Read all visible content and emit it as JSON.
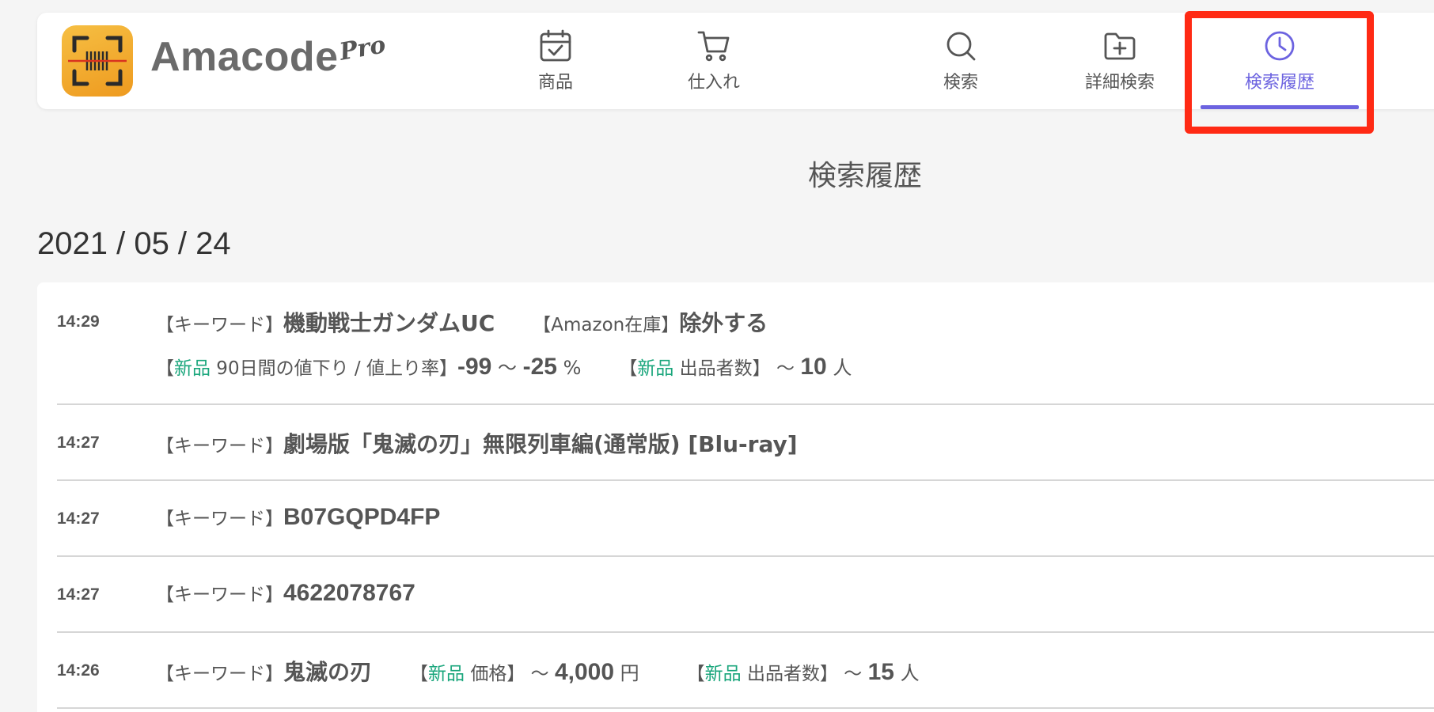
{
  "app": {
    "name": "Amacode",
    "pro_label": "Pro"
  },
  "nav": {
    "items": [
      {
        "label": "商品",
        "icon": "calendar-check-icon"
      },
      {
        "label": "仕入れ",
        "icon": "cart-icon"
      },
      {
        "label": "検索",
        "icon": "search-icon"
      },
      {
        "label": "詳細検索",
        "icon": "folder-plus-icon"
      },
      {
        "label": "検索履歴",
        "icon": "clock-icon",
        "active": true
      }
    ],
    "active_color": "#6c63e0",
    "highlight_color": "#ff2a14"
  },
  "page": {
    "title": "検索履歴",
    "date": "2021 / 05 / 24"
  },
  "history": [
    {
      "time": "14:29",
      "keyword_label": "【キーワード】",
      "keyword": "機動戦士ガンダムUC",
      "stock_label": "【Amazon在庫】",
      "stock_value": "除外する",
      "line2": {
        "open1": "【",
        "new1": "新品",
        "rate_label": " 90日間の値下り / 値上り率】",
        "rate_from": "-99",
        "tilde1": " 〜 ",
        "rate_to": "-25",
        "rate_unit": " %",
        "open2": "【",
        "new2": "新品",
        "sellers_label": " 出品者数】 〜 ",
        "sellers_value": "10",
        "sellers_unit": " 人"
      }
    },
    {
      "time": "14:27",
      "keyword_label": "【キーワード】",
      "keyword": "劇場版「鬼滅の刃」無限列車編(通常版) [Blu-ray]"
    },
    {
      "time": "14:27",
      "keyword_label": "【キーワード】",
      "keyword": "B07GQPD4FP"
    },
    {
      "time": "14:27",
      "keyword_label": "【キーワード】",
      "keyword": "4622078767"
    },
    {
      "time": "14:26",
      "keyword_label": "【キーワード】",
      "keyword": "鬼滅の刃",
      "price": {
        "open": "【",
        "new": "新品",
        "label": " 価格】 〜 ",
        "value": "4,000",
        "unit": " 円"
      },
      "sellers": {
        "open": "【",
        "new": "新品",
        "label": " 出品者数】 〜 ",
        "value": "15",
        "unit": " 人"
      }
    }
  ],
  "colors": {
    "new_tag": "#1aa67c"
  }
}
